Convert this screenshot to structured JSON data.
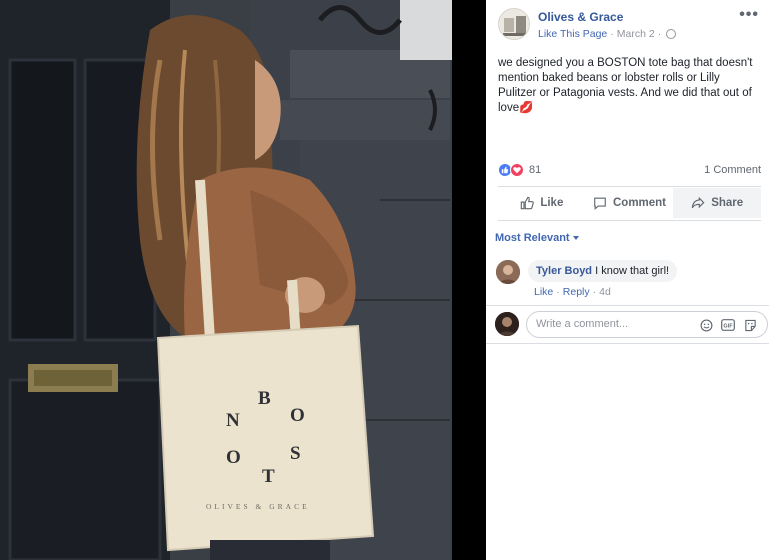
{
  "post": {
    "page_name": "Olives & Grace",
    "like_page": "Like This Page",
    "separator": "·",
    "date": "March 2",
    "text": "we designed you a BOSTON tote bag that doesn't mention baked beans or lobster rolls or Lilly Pulitzer or Patagonia vests. And we did that out of love💋",
    "more_label": "•••"
  },
  "photo": {
    "bag_letters": [
      "B",
      "N",
      "O",
      "O",
      "S",
      "T"
    ],
    "bag_brand": "OLIVES & GRACE"
  },
  "stats": {
    "reaction_count": "81",
    "comment_count": "1 Comment"
  },
  "actions": {
    "like": "Like",
    "comment": "Comment",
    "share": "Share"
  },
  "comments": {
    "sort_label": "Most Relevant",
    "items": [
      {
        "author": "Tyler Boyd",
        "text": "I know that girl!",
        "like": "Like",
        "reply": "Reply",
        "age": "4d"
      }
    ],
    "composer_placeholder": "Write a comment..."
  },
  "colors": {
    "link": "#365899",
    "like_blue": "#4a7bf5",
    "love_red": "#f0425f"
  }
}
